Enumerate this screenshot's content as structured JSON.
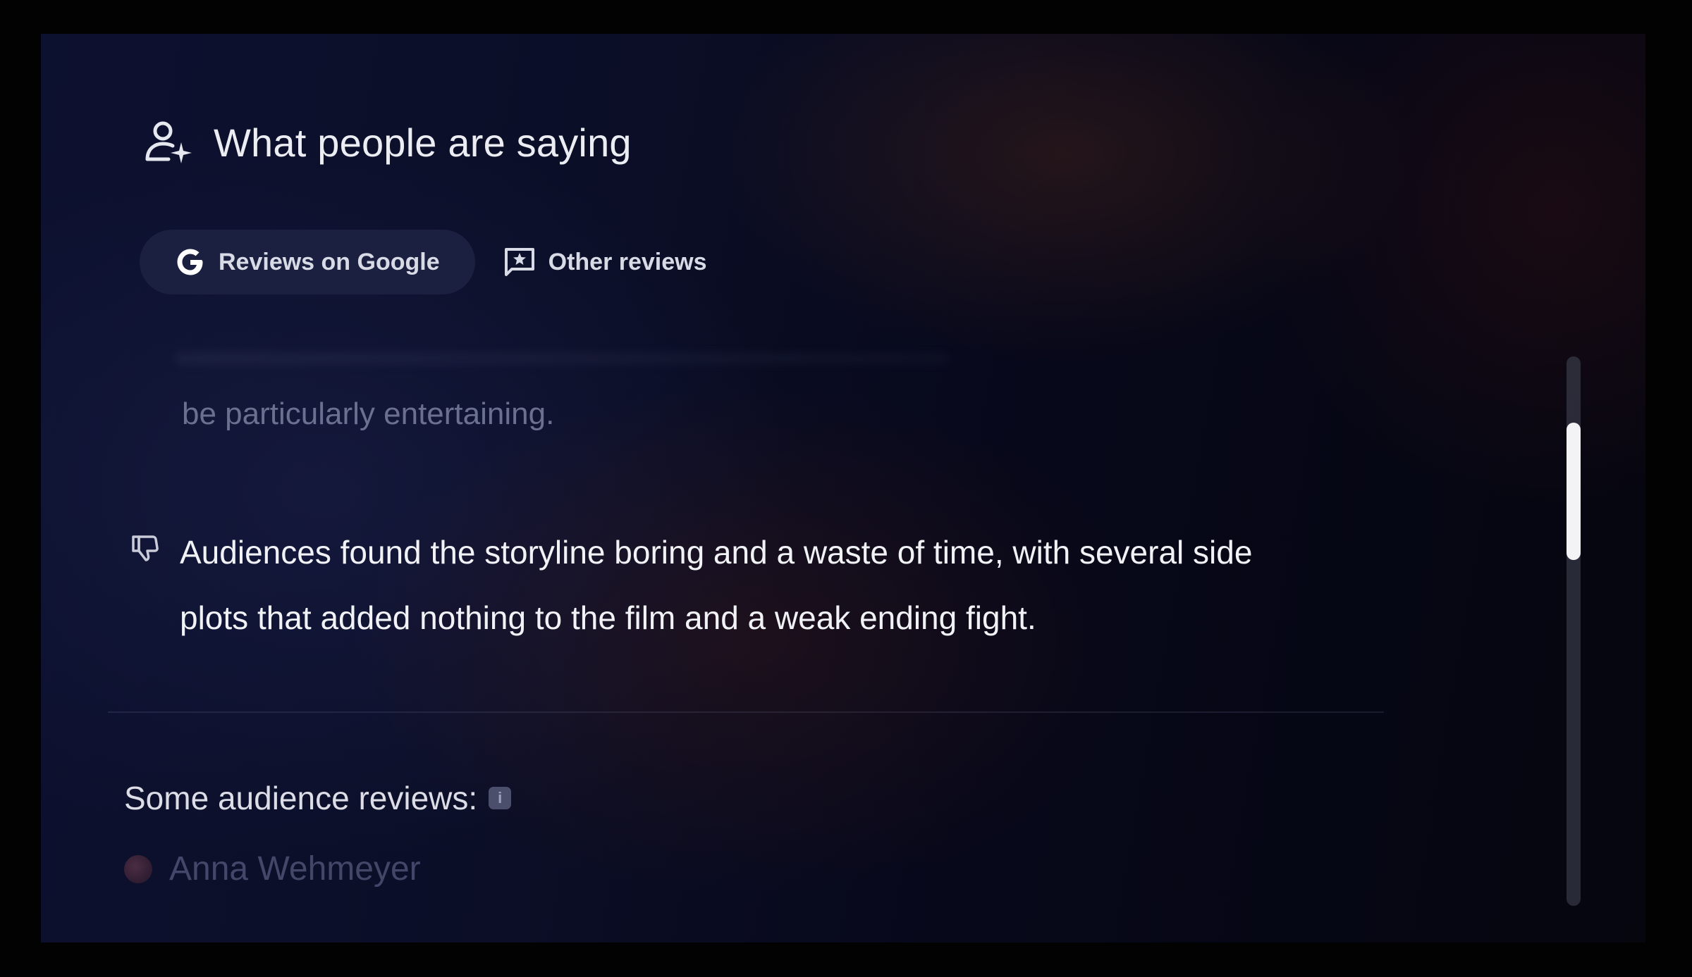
{
  "header": {
    "title": "What people are saying",
    "icon": "person-sparkle-icon"
  },
  "tabs": [
    {
      "label": "Reviews on Google",
      "icon": "google-g-icon",
      "selected": true
    },
    {
      "label": "Other reviews",
      "icon": "star-comment-icon",
      "selected": false
    }
  ],
  "summary": {
    "partial_text": "be particularly entertaining.",
    "con_text": "Audiences found the storyline boring and a waste of time, with several side plots that added nothing to the film and a weak ending fight.",
    "con_icon": "thumbs-down-icon"
  },
  "audience": {
    "label": "Some audience reviews:",
    "info_icon": "info-icon",
    "info_glyph": "i",
    "reviewers": [
      {
        "name": "Anna Wehmeyer"
      }
    ]
  },
  "colors": {
    "background": "#0b0e26",
    "selected_tab": "#1b1f40",
    "text_primary": "#f1f2f6",
    "text_faded": "#6c7090"
  }
}
